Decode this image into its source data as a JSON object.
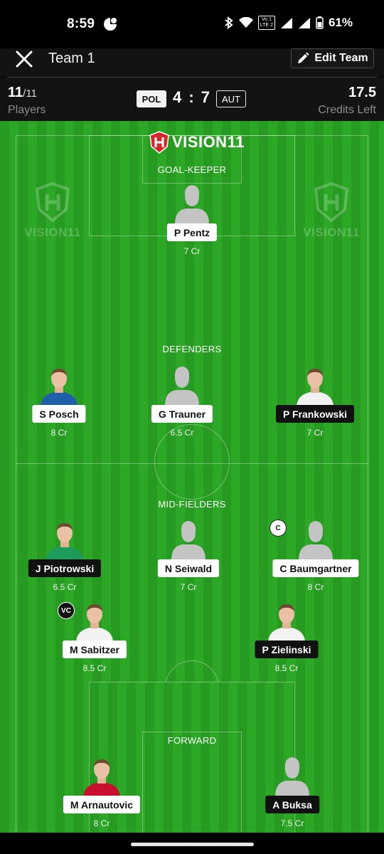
{
  "status": {
    "time": "8:59",
    "battery": "61%",
    "lte_line1": "Vo 1",
    "lte_line2": "LTE 2"
  },
  "header": {
    "title": "Team 1",
    "edit_label": "Edit Team"
  },
  "info": {
    "players_selected": "11",
    "players_total": "/11",
    "players_label": "Players",
    "team_left": "POL",
    "score": "4 : 7",
    "team_right": "AUT",
    "credits_left": "17.5",
    "credits_label": "Credits Left"
  },
  "brand": {
    "name": "VISION11"
  },
  "sections": {
    "goalkeeper": "GOAL-KEEPER",
    "defenders": "DEFENDERS",
    "midfielders": "MID-FIELDERS",
    "forward": "FORWARD"
  },
  "players": [
    {
      "name": "P Pentz",
      "credits": "7 Cr",
      "avatar": "placeholder",
      "style": "light"
    },
    {
      "name": "S Posch",
      "credits": "8 Cr",
      "avatar": "photo",
      "style": "light",
      "shirt": "#1f5ea8"
    },
    {
      "name": "G Trauner",
      "credits": "6.5 Cr",
      "avatar": "placeholder",
      "style": "light"
    },
    {
      "name": "P Frankowski",
      "credits": "7 Cr",
      "avatar": "photo",
      "style": "dark",
      "shirt": "#f2f2f2"
    },
    {
      "name": "J Piotrowski",
      "credits": "6.5 Cr",
      "avatar": "photo",
      "style": "dark",
      "shirt": "#1e9a5a"
    },
    {
      "name": "N Seiwald",
      "credits": "7 Cr",
      "avatar": "placeholder",
      "style": "light"
    },
    {
      "name": "C Baumgartner",
      "credits": "8 Cr",
      "avatar": "placeholder",
      "style": "light",
      "role": "C"
    },
    {
      "name": "M Sabitzer",
      "credits": "8.5 Cr",
      "avatar": "photo",
      "style": "light",
      "role": "VC",
      "shirt": "#f2f2f2"
    },
    {
      "name": "P Zielinski",
      "credits": "8.5 Cr",
      "avatar": "photo",
      "style": "dark",
      "shirt": "#f2f2f2"
    },
    {
      "name": "M Arnautovic",
      "credits": "8 Cr",
      "avatar": "photo",
      "style": "light",
      "shirt": "#c8102e"
    },
    {
      "name": "A Buksa",
      "credits": "7.5 Cr",
      "avatar": "placeholder",
      "style": "dark"
    }
  ],
  "colors": {
    "pitch_dark": "#279a21",
    "pitch_light": "#2da826",
    "header_bg": "#131313",
    "brand_red": "#d7262b"
  }
}
